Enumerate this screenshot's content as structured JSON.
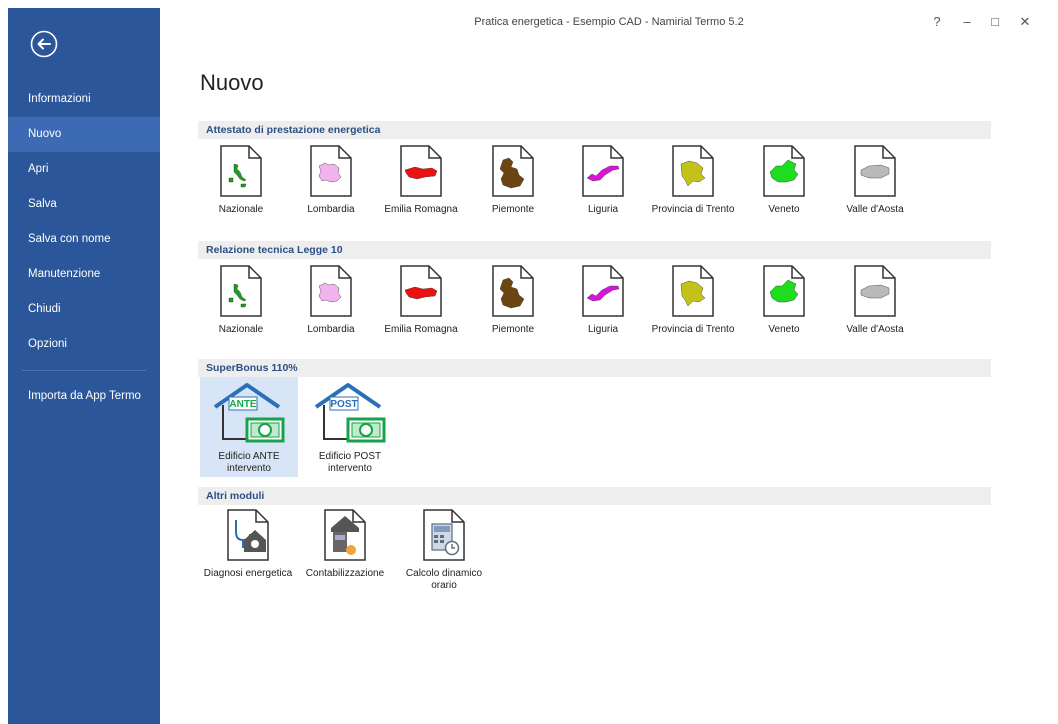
{
  "window": {
    "title": "Pratica energetica - Esempio CAD - Namirial Termo 5.2",
    "controls": [
      "?",
      "–",
      "□",
      "✕"
    ]
  },
  "sidebar": {
    "items": [
      {
        "label": "Informazioni"
      },
      {
        "label": "Nuovo",
        "active": true
      },
      {
        "label": "Apri"
      },
      {
        "label": "Salva"
      },
      {
        "label": "Salva con nome"
      },
      {
        "label": "Manutenzione"
      },
      {
        "label": "Chiudi"
      },
      {
        "label": "Opzioni"
      }
    ],
    "extra_item": "Importa da App Termo"
  },
  "page": {
    "title": "Nuovo"
  },
  "sections": {
    "ape": {
      "title": "Attestato di prestazione energetica",
      "tiles": [
        "Nazionale",
        "Lombardia",
        "Emilia Romagna",
        "Piemonte",
        "Liguria",
        "Provincia di Trento",
        "Veneto",
        "Valle d'Aosta"
      ]
    },
    "legge10": {
      "title": "Relazione tecnica Legge 10",
      "tiles": [
        "Nazionale",
        "Lombardia",
        "Emilia Romagna",
        "Piemonte",
        "Liguria",
        "Provincia di Trento",
        "Veneto",
        "Valle d'Aosta"
      ]
    },
    "superbonus": {
      "title": "SuperBonus 110%",
      "tiles": [
        {
          "line1": "Edificio ANTE",
          "line2": "intervento",
          "tag": "ANTE",
          "selected": true
        },
        {
          "line1": "Edificio POST",
          "line2": "intervento",
          "tag": "POST"
        }
      ]
    },
    "altri": {
      "title": "Altri moduli",
      "tiles": [
        {
          "line1": "Diagnosi energetica",
          "line2": ""
        },
        {
          "line1": "Contabilizzazione",
          "line2": ""
        },
        {
          "line1": "Calcolo dinamico",
          "line2": "orario"
        }
      ]
    }
  },
  "region_colors": {
    "Nazionale": "#1aa01a",
    "Lombardia": "#f3b3ef",
    "Emilia Romagna": "#ee1111",
    "Piemonte": "#6b4512",
    "Liguria": "#d814d8",
    "Provincia di Trento": "#c2c21a",
    "Veneto": "#1edc1e",
    "Valle d'Aosta": "#b9b9b9"
  },
  "icons": {
    "back": "back-arrow-icon",
    "document": "document-icon",
    "house_money": "house-money-icon",
    "diagnosis": "stethoscope-house-icon",
    "metering": "meter-house-icon",
    "dynamic_calc": "calculator-clock-icon"
  }
}
